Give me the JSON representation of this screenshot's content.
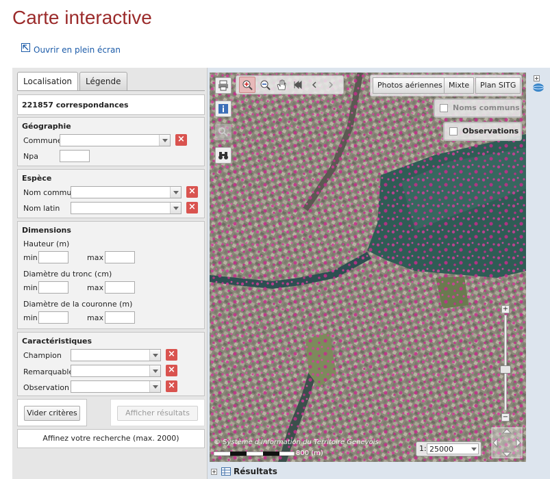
{
  "page": {
    "title": "Carte interactive",
    "fullscreen_link": "Ouvrir en plein écran"
  },
  "tabs": [
    {
      "label": "Localisation",
      "active": true
    },
    {
      "label": "Légende",
      "active": false
    }
  ],
  "search": {
    "count": "221857 correspondances",
    "geographie": {
      "header": "Géographie",
      "commune_label": "Commune",
      "npa_label": "Npa"
    },
    "espece": {
      "header": "Espèce",
      "nom_commun_label": "Nom commun",
      "nom_latin_label": "Nom latin"
    },
    "dimensions": {
      "header": "Dimensions",
      "hauteur_label": "Hauteur (m)",
      "diametre_tronc_label": "Diamètre du tronc (cm)",
      "diametre_couronne_label": "Diamètre de la couronne (m)",
      "min_label": "min",
      "max_label": "max"
    },
    "caracteristiques": {
      "header": "Caractéristiques",
      "champion_label": "Champion",
      "remarquable_label": "Remarquable",
      "observation_label": "Observation"
    },
    "clear_button": "Vider critères",
    "show_results_button": "Afficher résultats",
    "hint": "Affinez votre recherche (max. 2000)"
  },
  "map": {
    "map_types": [
      "Photos aériennes",
      "Mixte",
      "Plan SITG"
    ],
    "layers": {
      "noms_communs": "Noms communs",
      "observations": "Observations"
    },
    "copyright": "© Système d'Information du Territoire Genevois",
    "scale_text": "800 (m)",
    "scale_prefix": "1:",
    "scale_value": "25000"
  },
  "results": {
    "label": "Résultats"
  },
  "colors": {
    "title": "#9b2b2b",
    "link": "#1a5aa8",
    "clear_red": "#d9534f",
    "tree_magenta": "#d23c9a"
  }
}
